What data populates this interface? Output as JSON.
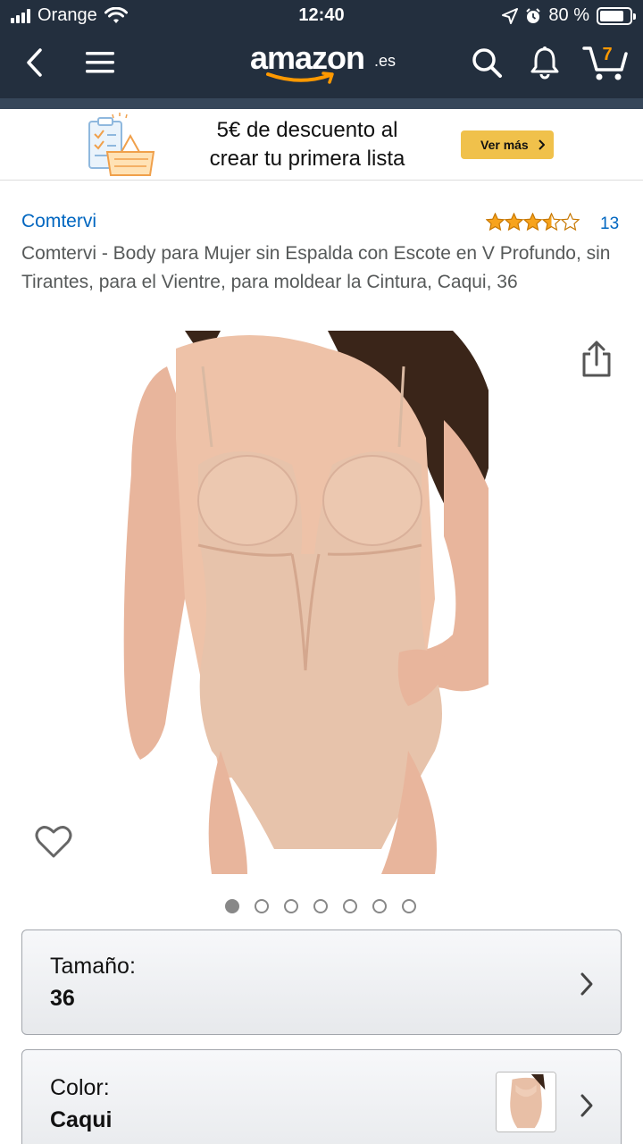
{
  "status_bar": {
    "carrier": "Orange",
    "time": "12:40",
    "battery": "80 %"
  },
  "nav": {
    "logo_word": "amazon",
    "logo_tld": ".es",
    "cart_count": "7"
  },
  "promo": {
    "line1": "5€ de descuento al",
    "line2": "crear tu primera lista",
    "button_label": "Ver más"
  },
  "product": {
    "brand": "Comtervi",
    "rating": 3.5,
    "rating_count": "13",
    "title": "Comtervi - Body para Mujer sin Espalda con Escote en V Profundo, sin Tirantes, para el Vientre, para moldear la Cintura, Caqui, 36"
  },
  "gallery": {
    "image_count": 7,
    "active_index": 0
  },
  "options": {
    "size_label": "Tamaño:",
    "size_value": "36",
    "color_label": "Color:",
    "color_value": "Caqui"
  },
  "colors": {
    "header_bg": "#232f3e",
    "link_blue": "#0066c0",
    "star_orange": "#f7a31c",
    "button_yellow": "#f0c14b",
    "cart_orange": "#ff9900"
  },
  "icons": {
    "back": "chevron-left-icon",
    "menu": "hamburger-icon",
    "search": "search-icon",
    "notifications": "bell-icon",
    "cart": "cart-icon",
    "share": "share-icon",
    "wishlist": "heart-icon"
  }
}
